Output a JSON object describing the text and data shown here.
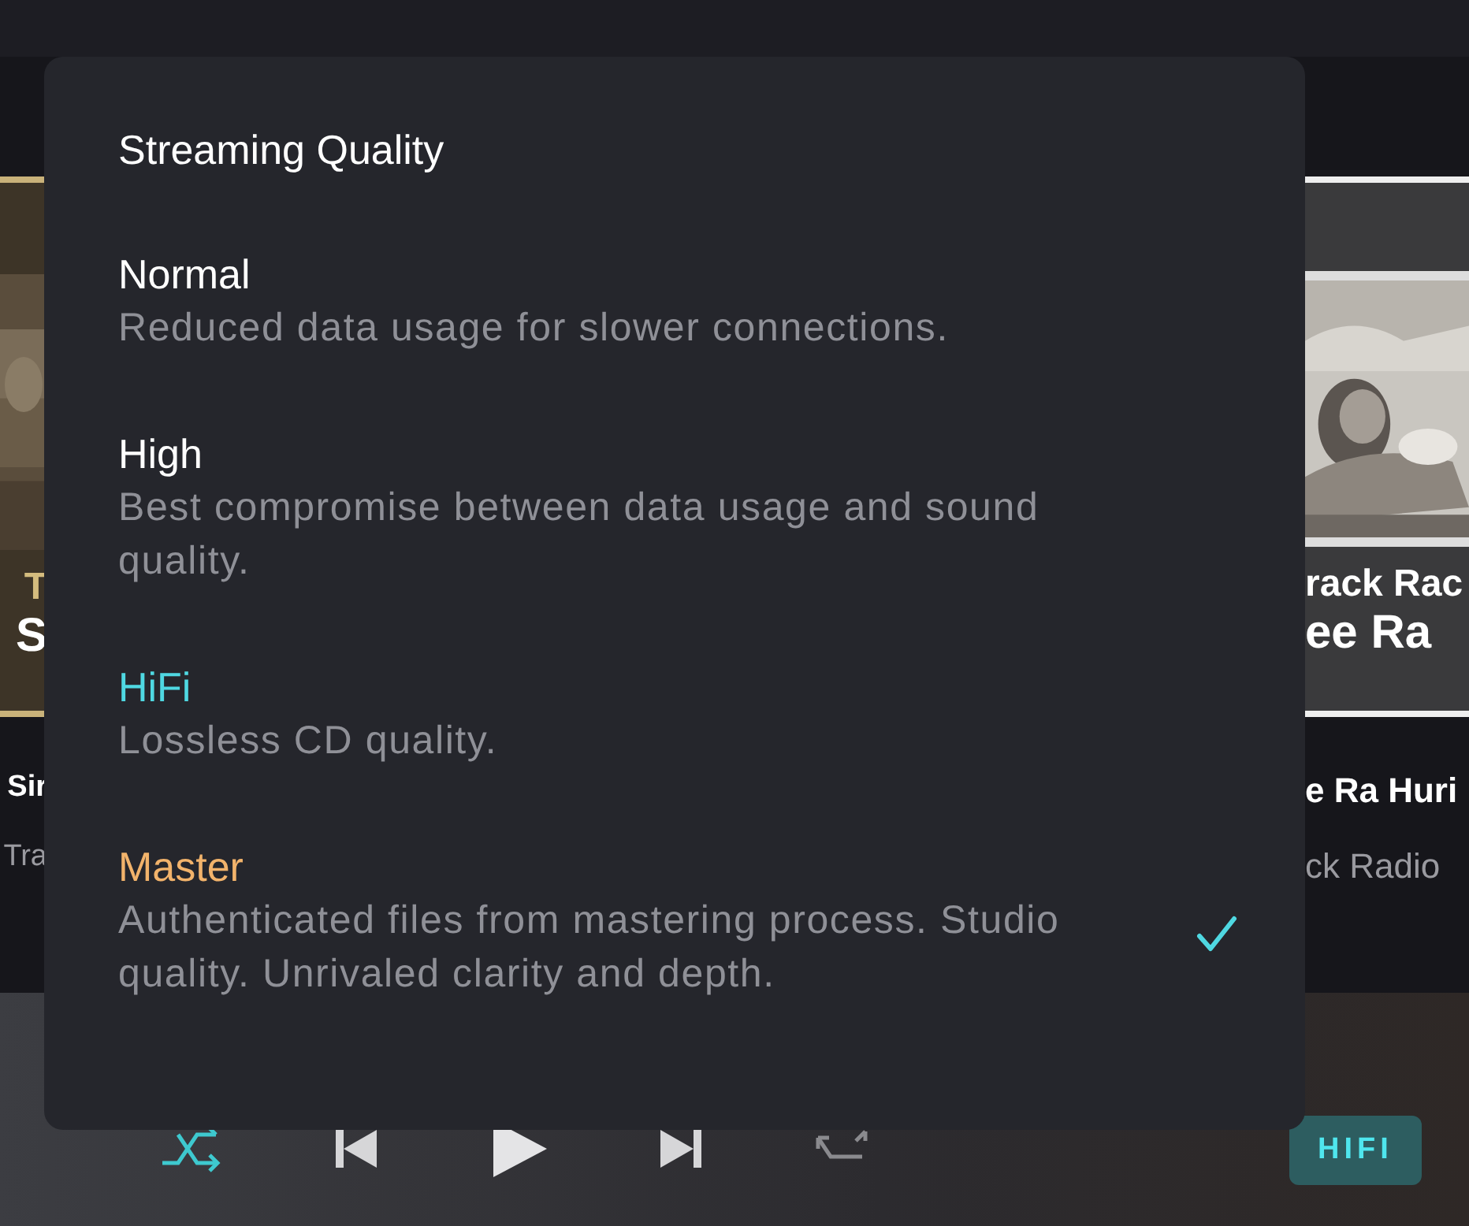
{
  "left_card": {
    "lines": [
      "T",
      "S"
    ],
    "title": "Sir",
    "subtitle": "Tra"
  },
  "right_card": {
    "lines": [
      "rack Rac",
      "ee Ra"
    ],
    "title": "e Ra Huri",
    "subtitle": "ck Radio"
  },
  "dialog": {
    "title": "Streaming Quality",
    "options": [
      {
        "name": "Normal",
        "description": "Reduced data usage for slower connections.",
        "color": "#ffffff",
        "selected": false
      },
      {
        "name": "High",
        "description": "Best compromise between data usage and sound quality.",
        "color": "#ffffff",
        "selected": false
      },
      {
        "name": "HiFi",
        "description": "Lossless CD quality.",
        "color": "#4fd8e2",
        "selected": false
      },
      {
        "name": "Master",
        "description": "Authenticated files from mastering process. Studio quality. Unrivaled clarity and depth.",
        "color": "#f2b36b",
        "selected": true
      }
    ]
  },
  "player": {
    "shuffle": {
      "on": true
    },
    "repeat": {
      "on": false
    },
    "quality_badge": "HIFI"
  }
}
